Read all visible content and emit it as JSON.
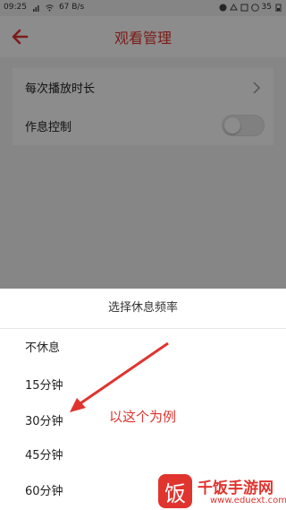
{
  "statusbar": {
    "time": "09:25",
    "speed": "67 B/s",
    "battery": "35"
  },
  "header": {
    "title": "观看管理"
  },
  "settings": {
    "row1_label": "每次播放时长",
    "row2_label": "作息控制"
  },
  "sheet": {
    "title": "选择休息频率",
    "options": [
      "不休息",
      "15分钟",
      "30分钟",
      "45分钟",
      "60分钟"
    ]
  },
  "annotation": {
    "text": "以这个为例",
    "color": "#e0342f"
  },
  "watermark": {
    "logo_char": "饭",
    "name": "千饭手游网",
    "url": "www.eduext.com"
  },
  "colors": {
    "accent": "#e0342f"
  }
}
